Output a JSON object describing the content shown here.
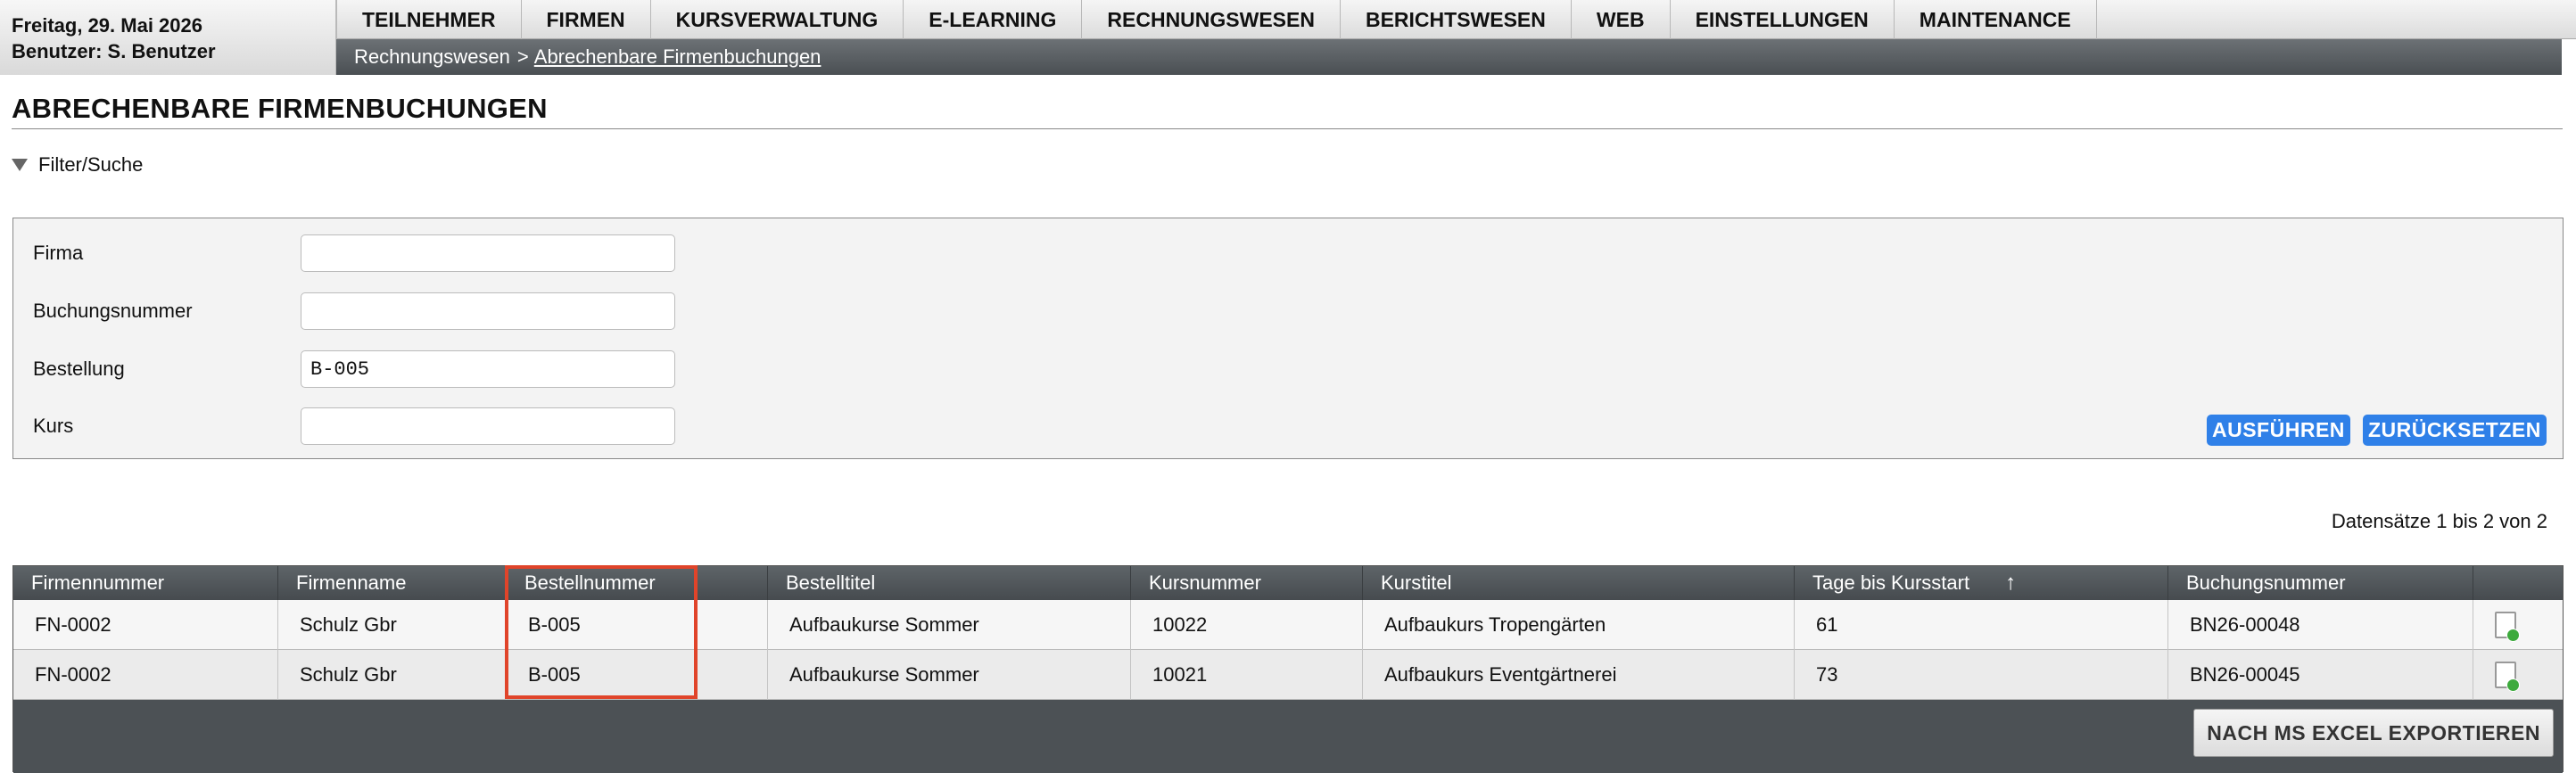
{
  "header": {
    "date": "Freitag, 29. Mai 2026",
    "user": "Benutzer: S. Benutzer"
  },
  "menu": [
    "TEILNEHMER",
    "FIRMEN",
    "KURSVERWALTUNG",
    "E-LEARNING",
    "RECHNUNGSWESEN",
    "BERICHTSWESEN",
    "WEB",
    "EINSTELLUNGEN",
    "MAINTENANCE"
  ],
  "breadcrumb": {
    "root": "Rechnungswesen",
    "separator": ">",
    "current": "Abrechenbare Firmenbuchungen"
  },
  "page": {
    "title": "ABRECHENBARE FIRMENBUCHUNGEN",
    "filter_toggle": "Filter/Suche"
  },
  "filter": {
    "fields": [
      {
        "label": "Firma",
        "value": ""
      },
      {
        "label": "Buchungsnummer",
        "value": ""
      },
      {
        "label": "Bestellung",
        "value": "B-005"
      },
      {
        "label": "Kurs",
        "value": ""
      }
    ],
    "run_label": "AUSFÜHREN",
    "reset_label": "ZURÜCKSETZEN"
  },
  "records_info": "Datensätze 1 bis 2 von 2",
  "table": {
    "columns": [
      "Firmennummer",
      "Firmenname",
      "Bestellnummer",
      "Bestelltitel",
      "Kursnummer",
      "Kurstitel",
      "Tage bis Kursstart",
      "Buchungsnummer",
      ""
    ],
    "sort_indicator": "↑",
    "rows": [
      [
        "FN-0002",
        "Schulz Gbr",
        "B-005",
        "Aufbaukurse Sommer",
        "10022",
        "Aufbaukurs Tropengärten",
        "61",
        "BN26-00048"
      ],
      [
        "FN-0002",
        "Schulz Gbr",
        "B-005",
        "Aufbaukurse Sommer",
        "10021",
        "Aufbaukurs Eventgärtnerei",
        "73",
        "BN26-00045"
      ]
    ],
    "export_label": "NACH MS EXCEL EXPORTIEREN"
  },
  "colors": {
    "accent_button": "#2f80e8",
    "highlight_border": "#e0442a",
    "table_header": "#5e6468"
  },
  "icons": {
    "row_action": "document-add-icon",
    "filter_toggle": "triangle-down-icon"
  }
}
